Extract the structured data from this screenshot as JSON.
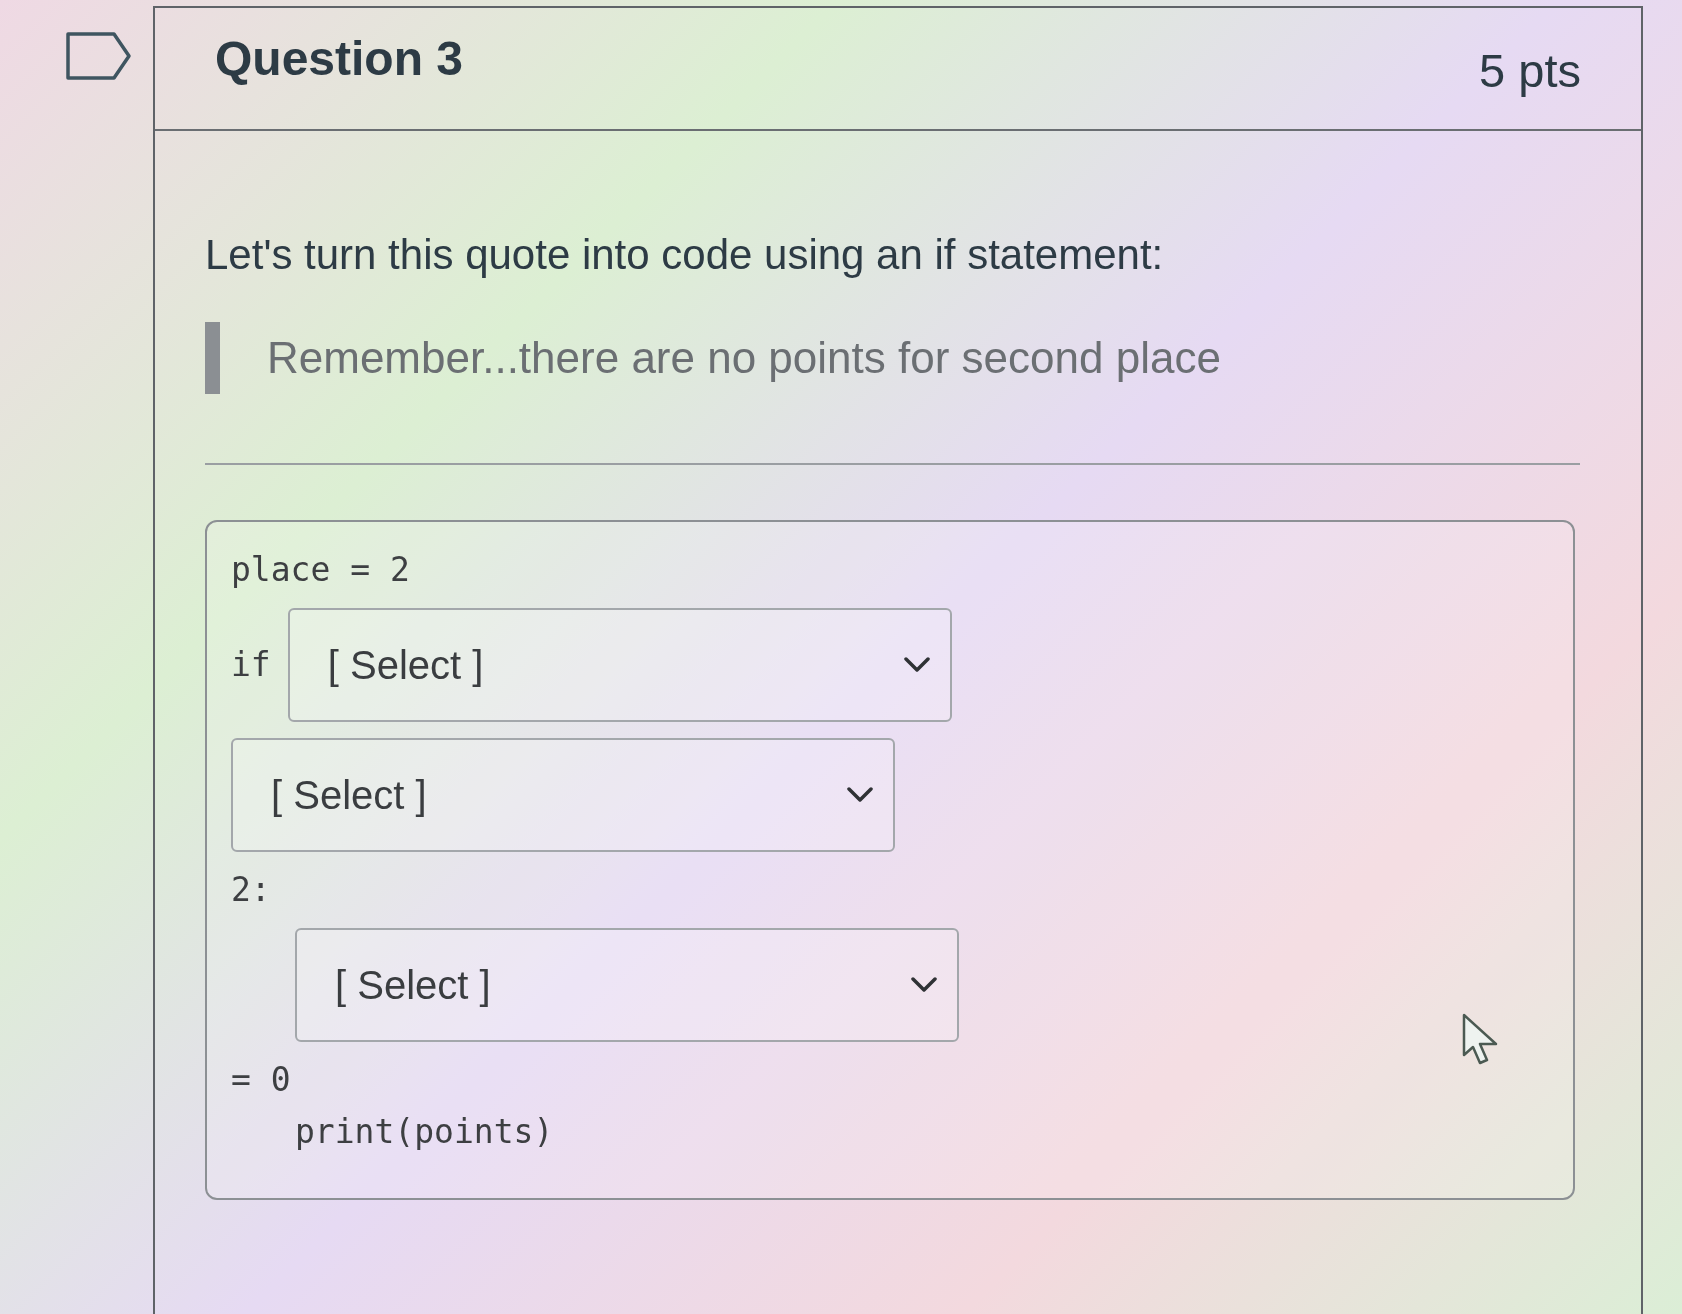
{
  "question": {
    "title": "Question 3",
    "points": "5 pts",
    "flagged": false
  },
  "prompt": "Let's turn this quote into code using an if statement:",
  "quote": "Remember...there are no points for second place",
  "code_lines": [
    {
      "parts": [
        {
          "kind": "code",
          "text": "place = 2"
        }
      ]
    },
    {
      "parts": [
        {
          "kind": "code",
          "text": "if"
        },
        {
          "kind": "select",
          "value": "[ Select ]"
        }
      ]
    },
    {
      "parts": [
        {
          "kind": "select",
          "value": "[ Select ]"
        }
      ]
    },
    {
      "parts": [
        {
          "kind": "code",
          "text": "2:"
        }
      ],
      "children": [
        {
          "parts": [
            {
              "kind": "select",
              "value": "[ Select ]"
            }
          ]
        }
      ]
    },
    {
      "parts": [
        {
          "kind": "code",
          "text": "= 0"
        }
      ],
      "children": [
        {
          "parts": [
            {
              "kind": "code",
              "text": "print(points)"
            }
          ]
        }
      ]
    }
  ]
}
